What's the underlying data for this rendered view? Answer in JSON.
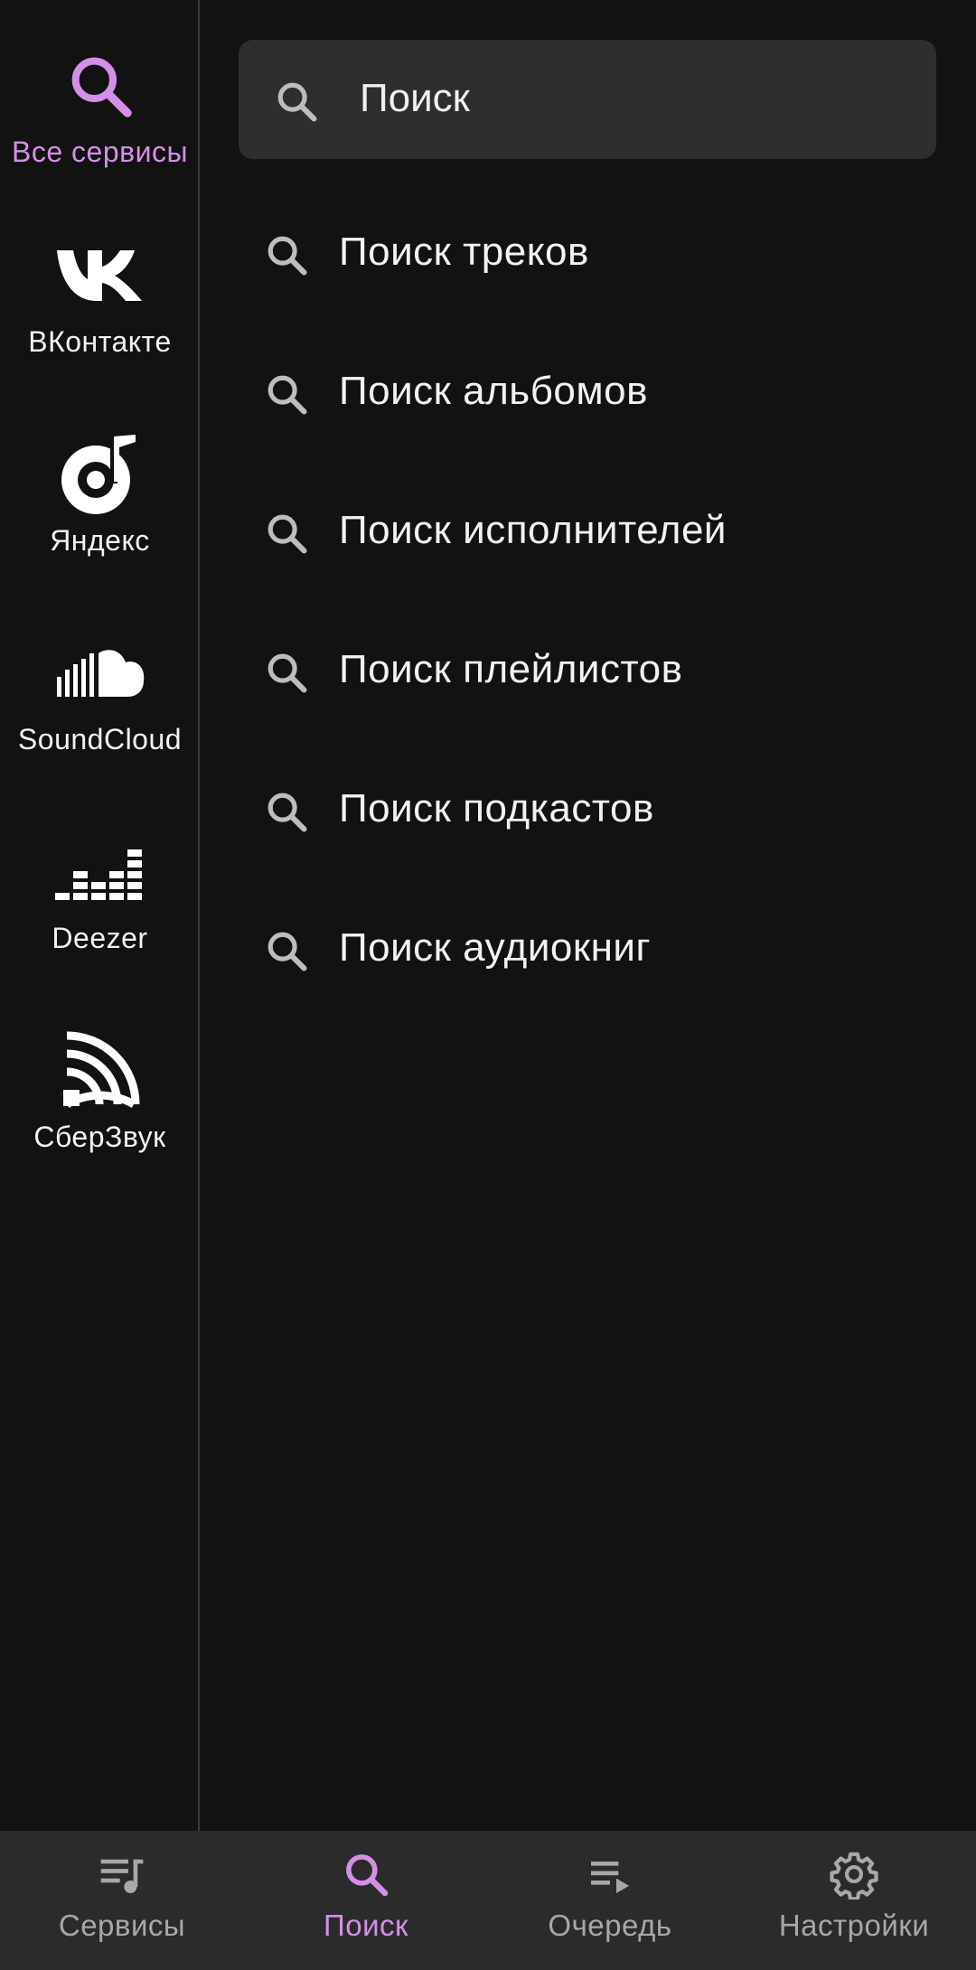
{
  "sidebar": {
    "items": [
      {
        "label": "Все сервисы",
        "icon": "search-icon",
        "active": true
      },
      {
        "label": "ВКонтакте",
        "icon": "vk-logo-icon"
      },
      {
        "label": "Яндекс",
        "icon": "yandex-music-icon"
      },
      {
        "label": "SoundCloud",
        "icon": "soundcloud-icon"
      },
      {
        "label": "Deezer",
        "icon": "deezer-icon"
      },
      {
        "label": "СберЗвук",
        "icon": "sberzvuk-icon"
      }
    ]
  },
  "search": {
    "placeholder": "Поиск",
    "options": [
      {
        "label": "Поиск треков"
      },
      {
        "label": "Поиск альбомов"
      },
      {
        "label": "Поиск исполнителей"
      },
      {
        "label": "Поиск плейлистов"
      },
      {
        "label": "Поиск подкастов"
      },
      {
        "label": "Поиск аудиокниг"
      }
    ]
  },
  "bottom_nav": {
    "items": [
      {
        "label": "Сервисы",
        "icon": "queue-music-icon"
      },
      {
        "label": "Поиск",
        "icon": "search-icon",
        "active": true
      },
      {
        "label": "Очередь",
        "icon": "playlist-play-icon"
      },
      {
        "label": "Настройки",
        "icon": "gear-icon"
      }
    ]
  },
  "colors": {
    "background": "#121212",
    "accent": "#d490e8",
    "nav_background": "#2b2b2b",
    "searchbar_background": "#2e2e2e"
  }
}
